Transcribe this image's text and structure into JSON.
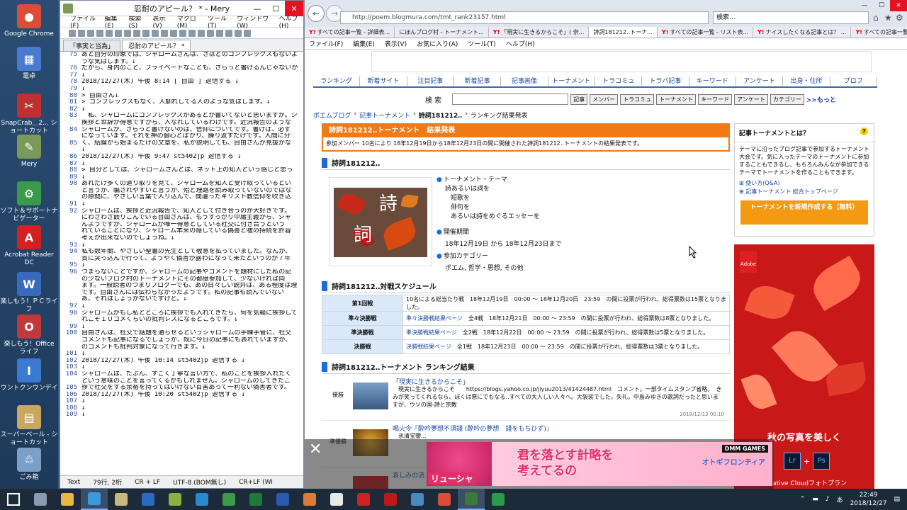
{
  "desktop": {
    "icons": [
      {
        "label": "Google Chrome",
        "color": "#dd4b39",
        "glyph": "●"
      },
      {
        "label": "電卓",
        "color": "#4a7ad0",
        "glyph": "▦"
      },
      {
        "label": "SnapCrab＿2... ショートカット",
        "color": "#c03030",
        "glyph": "✂"
      },
      {
        "label": "Mery",
        "color": "#7a9a5a",
        "glyph": "✎"
      },
      {
        "label": "ソフト＆サポートナビゲーター",
        "color": "#3a9a4a",
        "glyph": "⚙"
      },
      {
        "label": "Acrobat Reader DC",
        "color": "#d42020",
        "glyph": "A"
      },
      {
        "label": "楽しもう！ＰＣライフ",
        "color": "#3a6ac0",
        "glyph": "W"
      },
      {
        "label": "楽しもう！Office ライフ",
        "color": "#c03a3a",
        "glyph": "O"
      },
      {
        "label": "ウントクンウンデイ",
        "color": "#3a7ad0",
        "glyph": "I"
      },
      {
        "label": "スーパーベール - ショートカット",
        "color": "#c8a860",
        "glyph": "▤"
      },
      {
        "label": "ごみ箱",
        "color": "#7aa0c8",
        "glyph": "♲"
      }
    ]
  },
  "mery": {
    "title": "忍耐のアピール？ * - Mery",
    "menu": [
      "ファイル(F)",
      "編集(E)",
      "検索(S)",
      "表示(V)",
      "マクロ(M)",
      "ツール(T)",
      "ウィンドウ(W)",
      "ヘルプ(H)"
    ],
    "tabs": [
      "「事実と当為」",
      "忍耐のアピール？ *"
    ],
    "lines": [
      {
        "n": "75",
        "t": "あと自分の印象では、シャロームさんは、さほどのコンプレックスもないよ"
      },
      {
        "n": "",
        "t": "うな気はします。↓"
      },
      {
        "n": "76",
        "t": "だから、身内のこと、プライベートなことも、さらっと書けるんじゃないか"
      },
      {
        "n": "77",
        "t": "↓"
      },
      {
        "n": "78",
        "t": "2018/12/27(木) 午後 8:14 [ 自由 ] 返信する ↓"
      },
      {
        "n": "79",
        "t": "↓"
      },
      {
        "n": "80",
        "t": "> 自由さん↓"
      },
      {
        "n": "81",
        "t": "> コンプレックスもなく、人馴れしてる人のような気はします。↓"
      },
      {
        "n": "82",
        "t": "↓"
      },
      {
        "n": "83",
        "t": "　私、シャロームにコンプレックスがあるとか書いてないと思いますが。シ"
      },
      {
        "n": "",
        "t": "挨拶と世辞が得意ですから、人なれしているわけです。近況報告のような"
      },
      {
        "n": "84",
        "t": "シャロームが、さらっと書けないのは、信仰についてです。書けば、必ず"
      },
      {
        "n": "",
        "t": "になっています。それを神の御心とばかり、繰り返すだけです。人間に分"
      },
      {
        "n": "85",
        "t": "く、結論から始まるだけの文章を、私が説明しても、自由さんが見抜かな"
      },
      {
        "n": "",
        "t": "↓"
      },
      {
        "n": "86",
        "t": "2018/12/27(木) 午後 9:47 st5402jp 返信する ↓"
      },
      {
        "n": "87",
        "t": "↓"
      },
      {
        "n": "88",
        "t": "> 自分としては、シャロームさんとは、ネット上の知人という感じと思っ"
      },
      {
        "n": "89",
        "t": "↓"
      },
      {
        "n": "90",
        "t": "あれだけ多くの遣り取りを見て、シャロームを知人と受け取っているとい"
      },
      {
        "n": "",
        "t": "と言うか、騙されやすいと言うか、殆ど理路を読み取っていないのではな"
      },
      {
        "n": "",
        "t": "の隙間に、やさしい言葉で入り込んで、間違ったキリスト教信仰を吹き込"
      },
      {
        "n": "91",
        "t": "↓"
      },
      {
        "n": "92",
        "t": "シャロームは、挨拶と近況報告で、知人として付き合うのが大好きです。"
      },
      {
        "n": "",
        "t": "にわざわざ嵌りこんでいる自由さんは、もうすっかり中庸主義から、シャ"
      },
      {
        "n": "",
        "t": "んようですが、シャロームが唯一得意としている社交に付き合うという"
      },
      {
        "n": "",
        "t": "れていることになり、シャローム本来の隠している偽善と嘘の持続を許容"
      },
      {
        "n": "",
        "t": "考えが出来ないのでしょうね。↓"
      },
      {
        "n": "93",
        "t": "↓"
      },
      {
        "n": "94",
        "t": "私も数年間、やさしい聖書の先生として敬意を払っていました。なんか、"
      },
      {
        "n": "",
        "t": "質に突っ込んで行って、ようやく偽善が露わになって来たというのが７年"
      },
      {
        "n": "95",
        "t": "↓"
      },
      {
        "n": "96",
        "t": "つまらないことですが、シャロームの記事やコメントを題材にした私の記"
      },
      {
        "n": "",
        "t": "の少ないブログ村のトーナメントにその都度参加して、少ないければ同"
      },
      {
        "n": "",
        "t": "ます。一般読者のつまりブログーでも、あの白々しい説弁は、ある程度は理"
      },
      {
        "n": "",
        "t": "です。自由さんには伝わらなかったようです。私の記事も読んでいない"
      },
      {
        "n": "",
        "t": "あ、それはしょうがないですけど。↓"
      },
      {
        "n": "97",
        "t": "↓"
      },
      {
        "n": "98",
        "t": "シャロームがもし私とところに挨拶でも入れてきたら、何を気軽に挨拶して"
      },
      {
        "n": "",
        "t": "れこそ１０コメくらいの批判レスになるところです。↓"
      },
      {
        "n": "99",
        "t": "↓"
      },
      {
        "n": "100",
        "t": "自由さんは、社交で話題を通らせるというシャロームの手練手管に、社交"
      },
      {
        "n": "",
        "t": "コメントも記事になるでしょうが、既に今日の記事にも表れていますが、"
      },
      {
        "n": "",
        "t": "のコメントも批判対象になって行きます。↓"
      },
      {
        "n": "101",
        "t": "↓"
      },
      {
        "n": "102",
        "t": "2018/12/27(木) 午後 10:14 st5402jp 返信する ↓"
      },
      {
        "n": "103",
        "t": "↓"
      },
      {
        "n": "104",
        "t": "シャロームは、たぶん、すごく丁寧な言い方で、私のことを挨拶入れたく"
      },
      {
        "n": "",
        "t": "という意味のことを言ってくるかもしれません。シャロームのしてきたこ"
      },
      {
        "n": "105",
        "t": "拶で社交をする余裕を持ってはいけない百害あって一利ない偽善者です。"
      },
      {
        "n": "106",
        "t": "2018/12/27(木) 午後 10:20 st5402jp 返信する ↓"
      },
      {
        "n": "107",
        "t": "↓"
      },
      {
        "n": "108",
        "t": "↓"
      },
      {
        "n": "109",
        "t": "↓"
      }
    ],
    "status": {
      "mode": "Text",
      "pos": "79行, 2桁",
      "eol": "CR + LF",
      "enc": "UTF-8 (BOM無し)",
      "eol2": "CR+LF (Wi"
    }
  },
  "browser": {
    "url": "http://poem.blogmura.com/tmt_rank23157.html",
    "search_placeholder": "検索...",
    "tabs": [
      {
        "label": "すべての記事一覧 - 詳細表...",
        "y": "Y!"
      },
      {
        "label": "にほんブログ村 - トーナメント...",
        "y": ""
      },
      {
        "label": "「現実に生きるからこそ」( 奈...",
        "y": "Y!"
      },
      {
        "label": "詩詞181212‥トーナ...",
        "y": "",
        "active": true
      },
      {
        "label": "すべての記事一覧 - リスト表...",
        "y": "Y!"
      },
      {
        "label": "ナイスしたくなる記事とは？ ...",
        "y": "Y!"
      },
      {
        "label": "すべての記事一覧 - リスト表...",
        "y": "Y!"
      }
    ],
    "menu": [
      "ファイル(F)",
      "編集(E)",
      "表示(V)",
      "お気に入り(A)",
      "ツール(T)",
      "ヘルプ(H)"
    ]
  },
  "site": {
    "nav": [
      "ランキング",
      "新着サイト",
      "注目記事",
      "新着記事",
      "記事画像",
      "トーナメント",
      "トラコミュ",
      "トラバ記事",
      "キーワード",
      "アンケート",
      "出身・住所",
      "プロフ"
    ],
    "search_label": "検 索",
    "search_buttons": [
      "記事",
      "メンバー",
      "トラコミュ",
      "トーナメント",
      "キーワード",
      "アンケート",
      "カテゴリー"
    ],
    "more": ">>もっと",
    "crumbs": [
      "ポエムブログ",
      "記事トーナメント",
      "詩詞181212‥",
      "ランキング結果発表"
    ],
    "result_title": "詩詞181212‥トーナメント　結果発表",
    "result_desc": "参加メンバー 10名により 18年12月19日から18年12月23日の間に開催された詩詞181212‥トーナメントの結果発表です。",
    "tournament_heading": "詩詞181212‥",
    "thumb_kanji": [
      "詩",
      "詞"
    ],
    "theme_label": "トーナメント・テーマ",
    "theme_lines": [
      "詩あるいは詞を",
      "短歌を",
      "俳句を",
      "あるいは詩をめぐるエッセーを"
    ],
    "period_label": "開催期間",
    "period_value": "18年12月19日 から 18年12月23日まで",
    "category_label": "参加カテゴリー",
    "category_value": "ポエム, 哲学・思想, その他",
    "schedule_heading": "詩詞181212‥対戦スケジュール",
    "schedule": [
      {
        "k": "第1回戦",
        "link": "",
        "v": "10名による総当たり戦　18年12月19日　00:00 ～ 18年12月20日　23:59　の間に投票が行われ、総得票数は15票となりました。"
      },
      {
        "k": "準々決勝戦",
        "link": "準々決勝戦結果ページ",
        "v": "全4戦　18年12月21日　00:00 ～ 23:59　の間に投票が行われ、総得票数は8票となりました。"
      },
      {
        "k": "準決勝戦",
        "link": "準決勝戦結果ページ",
        "v": "全2戦　18年12月22日　00:00 ～ 23:59　の間に投票が行われ、総得票数は5票となりました。"
      },
      {
        "k": "決勝戦",
        "link": "決勝戦結果ページ",
        "v": "全1戦　18年12月23日　00:00 ～ 23:59　の間に投票が行われ、総得票数は3票となりました。"
      }
    ],
    "ranking_heading": "詩詞181212‥トーナメント ランキング結果",
    "ranking": [
      {
        "label": "優勝",
        "title": "「現実に生きるからこそ」",
        "body": "　現実に生きるからこそ　　https://blogs.yahoo.co.jp/jiyuu2013/41424487.html　コメント。一部タイムスタンプ省略。　きみが笑ってくれるなら、ぼくは悪にでもなる‥すべての大人しい人々へ。大袈裟でした。失礼。中島みゆきの歌詞だったと思いますが、ウソの国‐詩と宗教",
        "date": "2018/12/13 00:10"
      },
      {
        "label": "準優勝",
        "title": "喝火令『酔吟夢想不須錢 (酔吟の夢想　錢をもちひず)』",
        "body": "　氷清宝鑒…",
        "date": ""
      },
      {
        "label": "",
        "title": "哀しみの流",
        "body": "",
        "date": ""
      }
    ],
    "side_title": "記事トーナメントとは？",
    "side_text": "テーマに沿ったブログ記事で参加するトーナメント大会です。気に入ったテーマのトーナメントに参加することもできるし、もちろんみんなが参加できるテーマでトーナメントを作ることもできます。",
    "side_links": [
      "使い方(Q&A)",
      "記事トーナメント 総合トップページ"
    ],
    "side_cta": "トーナメントを新規作成する（無料）",
    "ad_caption": "秋の写真を美しく",
    "ad_sub": "Creative Cloudフォトプラン",
    "ad_brand": "Adobe",
    "dmm_name": "リューシャ",
    "dmm_msg_1": "君を落とす計略を",
    "dmm_msg_2": "考えてるの",
    "dmm_brand": "DMM GAMES",
    "dmm_logo": "オトギフロンティア"
  },
  "taskbar": {
    "apps": [
      {
        "name": "windows-start",
        "color": "#3a8ae0"
      },
      {
        "name": "task-view",
        "color": "#8a9ab0"
      },
      {
        "name": "explorer",
        "color": "#e8b840"
      },
      {
        "name": "internet-explorer",
        "color": "#3a9ae0",
        "active": true
      },
      {
        "name": "notepad",
        "color": "#c8b880"
      },
      {
        "name": "outlook",
        "color": "#2a6ac0"
      },
      {
        "name": "paint",
        "color": "#8ab040"
      },
      {
        "name": "screen",
        "color": "#2a8ad0"
      },
      {
        "name": "support",
        "color": "#3a9a4a"
      },
      {
        "name": "excel",
        "color": "#1f7a3a"
      },
      {
        "name": "word",
        "color": "#2a5ab0"
      },
      {
        "name": "game",
        "color": "#e07a3a"
      },
      {
        "name": "pen",
        "color": "#e8e8e8"
      },
      {
        "name": "r-app",
        "color": "#d02020"
      },
      {
        "name": "mcafee",
        "color": "#c01818"
      },
      {
        "name": "tablet",
        "color": "#4a8ac0"
      },
      {
        "name": "chrome",
        "color": "#dd4b39"
      },
      {
        "name": "mery",
        "color": "#3a7a3a",
        "active": true
      },
      {
        "name": "green-app",
        "color": "#2a9a4a"
      }
    ],
    "time": "22:49",
    "date": "2018/12/27"
  }
}
